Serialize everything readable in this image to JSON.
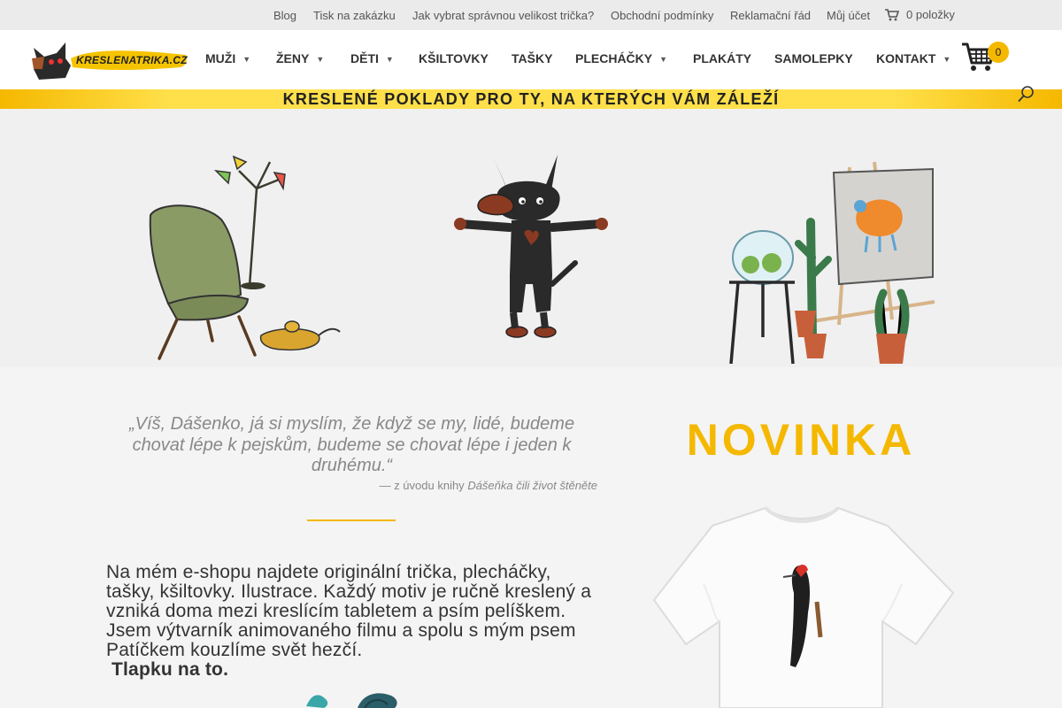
{
  "topbar": {
    "links": [
      "Blog",
      "Tisk na zakázku",
      "Jak vybrat správnou velikost trička?",
      "Obchodní podmínky",
      "Reklamační řád",
      "Můj účet"
    ],
    "cart_label": "0 položky"
  },
  "logo": {
    "text": "KRESLENATRIKA.CZ"
  },
  "nav": {
    "items": [
      {
        "label": "MUŽI",
        "has_dropdown": true
      },
      {
        "label": "ŽENY",
        "has_dropdown": true
      },
      {
        "label": "DĚTI",
        "has_dropdown": true
      },
      {
        "label": "KŠILTOVKY",
        "has_dropdown": false
      },
      {
        "label": "TAŠKY",
        "has_dropdown": false
      },
      {
        "label": "PLECHÁČKY",
        "has_dropdown": true
      },
      {
        "label": "PLAKÁTY",
        "has_dropdown": false
      },
      {
        "label": "SAMOLEPKY",
        "has_dropdown": false
      },
      {
        "label": "KONTAKT",
        "has_dropdown": true
      }
    ],
    "cart_count": "0"
  },
  "banner": {
    "text": "KRESLENÉ POKLADY PRO TY, NA KTERÝCH VÁM ZÁLEŽÍ"
  },
  "quote": {
    "text": "„Víš, Dášenko, já si myslím, že když se my, lidé, budeme chovat lépe k pejskům, budeme se chovat lépe i jeden k druhému.“",
    "source_prefix": "— z úvodu knihy",
    "source_title": "Dášeňka čili život štěněte"
  },
  "intro": {
    "text": "Na mém e-shopu najdete originální trička, plecháčky, tašky, kšiltovky. Ilustrace. Každý motiv je ručně kreslený a vzniká doma mezi kreslícím tabletem a psím pelíškem. Jsem výtvarník animovaného filmu a spolu s mým psem Patíčkem kouzlíme svět hezčí.",
    "cta": "Tlapku na to. "
  },
  "novinka": {
    "title": "NOVINKA"
  },
  "colors": {
    "accent": "#f5b800",
    "text": "#333333",
    "muted": "#888888"
  },
  "icons": [
    "cart-icon",
    "search-icon",
    "chevron-down-icon"
  ]
}
